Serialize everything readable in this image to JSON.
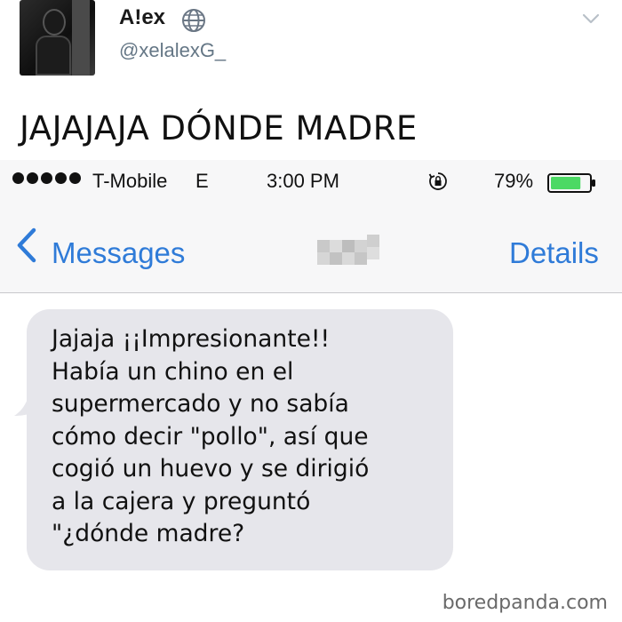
{
  "tweet": {
    "display_name": "A!ex",
    "handle": "@xelalexG_",
    "text": "JAJAJAJA DÓNDE MADRE",
    "icons": {
      "verified": "globe-icon",
      "menu": "chevron-down-icon"
    }
  },
  "status_bar": {
    "carrier": "T-Mobile",
    "network": "E",
    "time": "3:00 PM",
    "battery": "79%",
    "battery_level": 0.79,
    "battery_color": "#4cd964"
  },
  "nav": {
    "back_label": "Messages",
    "details_label": "Details",
    "accent_color": "#2f7bd8"
  },
  "message": {
    "text": "Jajaja ¡¡Impresionante!!\nHabía un chino en el\nsupermercado y no sabía\ncómo decir \"pollo\", así que\ncogió un huevo y se dirigió\na la cajera y preguntó\n\"¿dónde madre?",
    "bubble_color": "#e6e6eb"
  },
  "watermark": "boredpanda.com"
}
